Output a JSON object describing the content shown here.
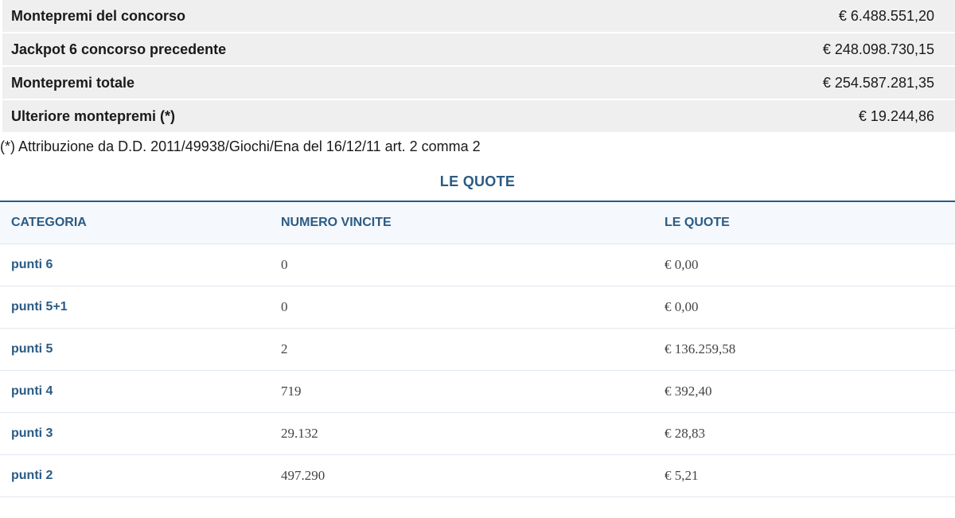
{
  "summary": [
    {
      "label": "Montepremi del concorso",
      "value": "€ 6.488.551,20"
    },
    {
      "label": "Jackpot 6 concorso precedente",
      "value": "€ 248.098.730,15"
    },
    {
      "label": "Montepremi totale",
      "value": "€ 254.587.281,35"
    },
    {
      "label": "Ulteriore montepremi (*)",
      "value": "€ 19.244,86"
    }
  ],
  "footnote": "(*) Attribuzione da D.D. 2011/49938/Giochi/Ena del 16/12/11 art. 2 comma 2",
  "quote_section": {
    "title": "LE QUOTE",
    "headers": [
      "CATEGORIA",
      "NUMERO VINCITE",
      "LE QUOTE"
    ],
    "rows": [
      {
        "category": "punti 6",
        "wins": "0",
        "quota": "€ 0,00"
      },
      {
        "category": "punti 5+1",
        "wins": "0",
        "quota": "€ 0,00"
      },
      {
        "category": "punti 5",
        "wins": "2",
        "quota": "€ 136.259,58"
      },
      {
        "category": "punti 4",
        "wins": "719",
        "quota": "€ 392,40"
      },
      {
        "category": "punti 3",
        "wins": "29.132",
        "quota": "€ 28,83"
      },
      {
        "category": "punti 2",
        "wins": "497.290",
        "quota": "€ 5,21"
      }
    ]
  },
  "colors": {
    "accent": "#2a5b84",
    "summary_bg": "#efefef",
    "header_bg": "#f5f8fc",
    "row_border": "#dfe7ef"
  }
}
